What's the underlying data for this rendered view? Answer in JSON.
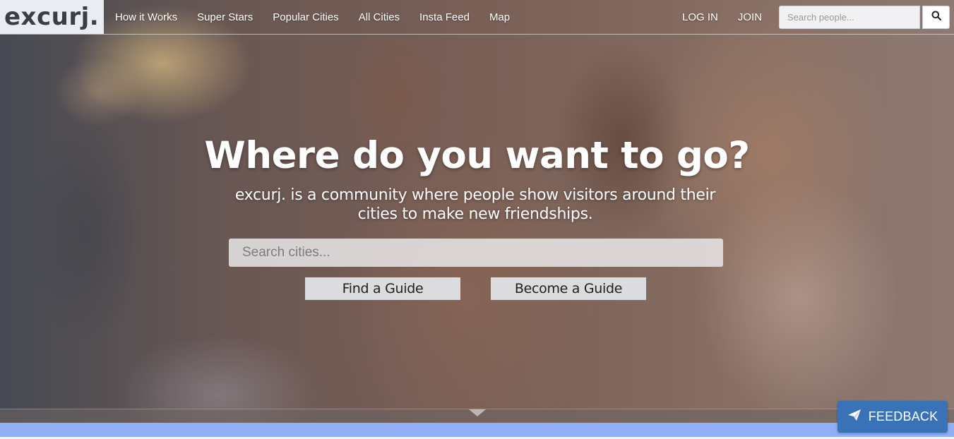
{
  "brand": {
    "logo_text": "excurj."
  },
  "nav": {
    "items": [
      {
        "label": "How it Works"
      },
      {
        "label": "Super Stars"
      },
      {
        "label": "Popular Cities"
      },
      {
        "label": "All Cities"
      },
      {
        "label": "Insta Feed"
      },
      {
        "label": "Map"
      }
    ],
    "login_label": "LOG IN",
    "join_label": "JOIN",
    "people_search_placeholder": "Search people...",
    "search_icon": "search-icon"
  },
  "hero": {
    "headline": "Where do you want to go?",
    "subline": "excurj. is a community where people show visitors around their cities to make new friendships.",
    "city_search_placeholder": "Search cities...",
    "find_guide_label": "Find a Guide",
    "become_guide_label": "Become a Guide"
  },
  "feedback": {
    "label": "FEEDBACK",
    "icon": "paper-plane-icon"
  },
  "colors": {
    "feedback_bg": "#3a72b8",
    "bottom_bar": "#8fb0f5",
    "logo_bg": "#e9ecf0"
  }
}
